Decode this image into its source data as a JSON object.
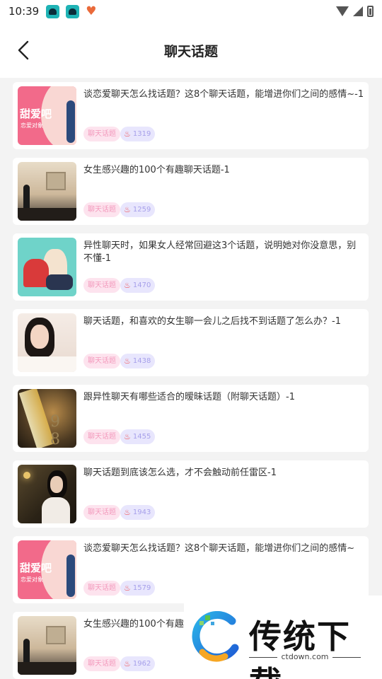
{
  "status": {
    "time": "10:39"
  },
  "nav": {
    "title": "聊天话题"
  },
  "list": {
    "items": [
      {
        "title": "谈恋爱聊天怎么找话题？这8个聊天话题，能增进你们之间的感情~-1",
        "tag": "聊天话题",
        "views": "1319",
        "thumb": "pink",
        "thumb_text": "甜爱吧",
        "thumb_sub": "恋爱对象"
      },
      {
        "title": "女生感兴趣的100个有趣聊天话题-1",
        "tag": "聊天话题",
        "views": "1259",
        "thumb": "street"
      },
      {
        "title": "异性聊天时，如果女人经常回避这3个话题，说明她对你没意思，别不懂-1",
        "tag": "聊天话题",
        "views": "1470",
        "thumb": "couple"
      },
      {
        "title": "聊天话题，和喜欢的女生聊一会儿之后找不到话题了怎么办？-1",
        "tag": "聊天话题",
        "views": "1438",
        "thumb": "girl"
      },
      {
        "title": "跟异性聊天有哪些适合的暧昧话题（附聊天话题）-1",
        "tag": "聊天话题",
        "views": "1455",
        "thumb": "glass"
      },
      {
        "title": "聊天话题到底该怎么选，才不会触动前任雷区-1",
        "tag": "聊天话题",
        "views": "1943",
        "thumb": "dark"
      },
      {
        "title": "谈恋爱聊天怎么找话题？这8个聊天话题，能增进你们之间的感情~",
        "tag": "聊天话题",
        "views": "1579",
        "thumb": "pink",
        "thumb_text": "甜爱吧",
        "thumb_sub": "恋爱对象"
      },
      {
        "title": "女生感兴趣的100个有趣聊天话题",
        "tag": "聊天话题",
        "views": "1962",
        "thumb": "street"
      }
    ]
  },
  "watermark": {
    "title": "传统下载",
    "url": "ctdown.com"
  },
  "colors": {
    "tag_bg": "#fde3ee",
    "tag_text": "#f39bbd",
    "views_bg": "#e8e6fd",
    "views_text": "#a7a0ea",
    "fire": "#f0494c"
  },
  "icons": {
    "back": "chevron-left-icon",
    "views": "fire-icon",
    "wifi": "wifi-icon",
    "signal": "signal-icon",
    "battery": "battery-icon"
  }
}
